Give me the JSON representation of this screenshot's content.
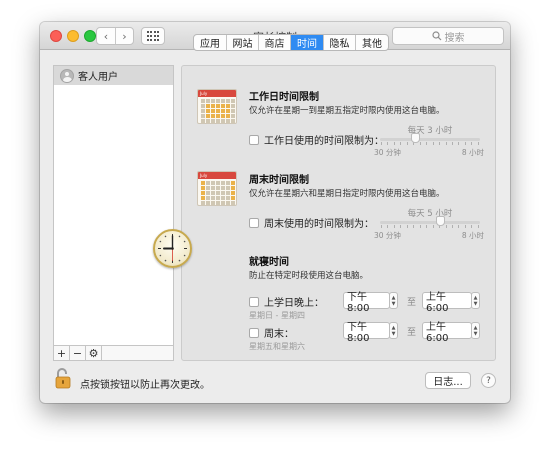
{
  "window": {
    "title": "家长控制",
    "search_placeholder": "搜索",
    "nav_back": "‹",
    "nav_forward": "›"
  },
  "sidebar": {
    "users": [
      {
        "label": "客人用户"
      }
    ],
    "add_label": "+",
    "remove_label": "−",
    "action_label": "⚙"
  },
  "tabs": [
    {
      "label": "应用",
      "active": false
    },
    {
      "label": "网站",
      "active": false
    },
    {
      "label": "商店",
      "active": false
    },
    {
      "label": "时间",
      "active": true
    },
    {
      "label": "隐私",
      "active": false
    },
    {
      "label": "其他",
      "active": false
    }
  ],
  "weekday": {
    "title": "工作日时间限制",
    "desc": "仅允许在星期一到星期五指定时限内使用这台电脑。",
    "checkbox_label": "工作日使用的时间限制为：",
    "checked": false,
    "slider_value": "每天 3 小时",
    "slider_fraction": 0.35,
    "slider_min": "30 分钟",
    "slider_max": "8 小时",
    "calendar_month": "July"
  },
  "weekend": {
    "title": "周末时间限制",
    "desc": "仅允许在星期六和星期日指定时限内使用这台电脑。",
    "checkbox_label": "周末使用的时间限制为：",
    "checked": false,
    "slider_value": "每天 5 小时",
    "slider_fraction": 0.6,
    "slider_min": "30 分钟",
    "slider_max": "8 小时",
    "calendar_month": "July"
  },
  "bedtime": {
    "title": "就寝时间",
    "desc": "防止在特定时段使用这台电脑。",
    "to_label": "至",
    "school_nights": {
      "label": "上学日晚上：",
      "sub": "星期日 - 星期四",
      "checked": false,
      "start": "下午 8:00",
      "end": "上午 6:00"
    },
    "weekend": {
      "label": "周末：",
      "sub": "星期五和星期六",
      "checked": false,
      "start": "下午 8:00",
      "end": "上午 6:00"
    }
  },
  "footer": {
    "lock_text": "点按锁按钮以防止再次更改。",
    "log_button": "日志...",
    "help_button": "?"
  },
  "colors": {
    "accent": "#2f8bf2",
    "window_bg": "#ececec",
    "calendar_header": "#d8483d",
    "lock_gold": "#e6a53c"
  },
  "icons": {
    "lock": "lock-open-icon",
    "clock": "clock-icon",
    "calendar": "calendar-icon",
    "search": "search-icon",
    "gear": "gear-icon"
  }
}
